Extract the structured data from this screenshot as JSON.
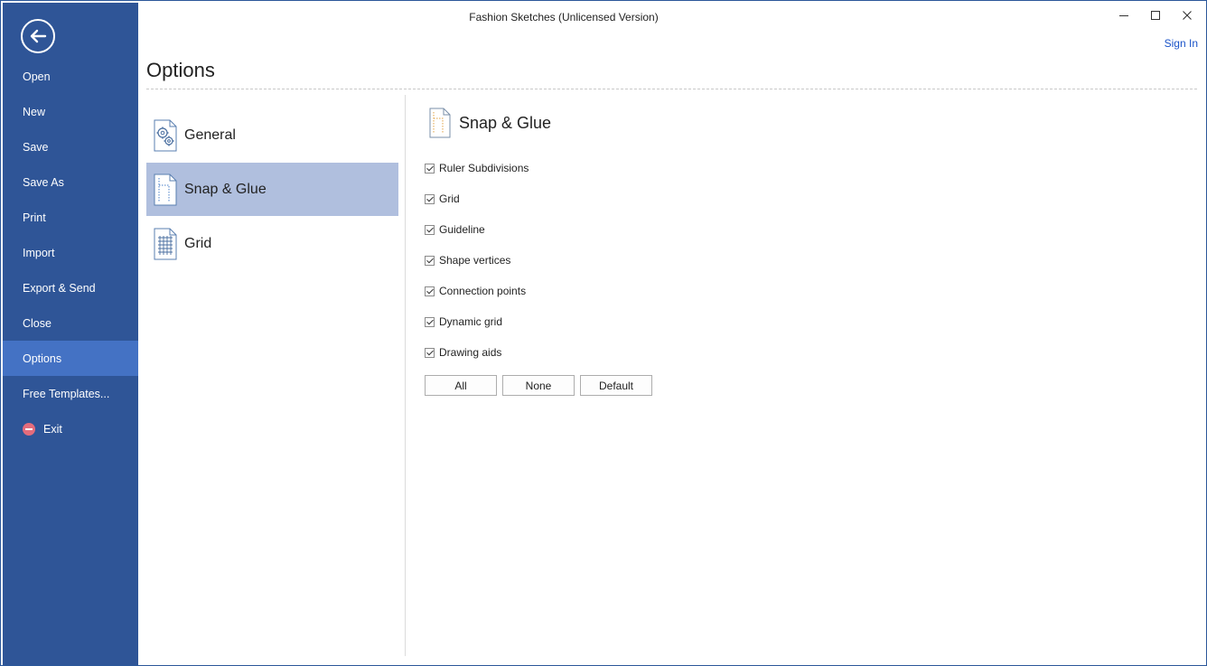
{
  "window": {
    "title": "Fashion Sketches (Unlicensed Version)",
    "sign_in": "Sign In",
    "controls": {
      "minimize": "—",
      "maximize": "☐",
      "close": "✕"
    }
  },
  "sidebar": {
    "items": [
      {
        "label": "Open"
      },
      {
        "label": "New"
      },
      {
        "label": "Save"
      },
      {
        "label": "Save As"
      },
      {
        "label": "Print"
      },
      {
        "label": "Import"
      },
      {
        "label": "Export & Send"
      },
      {
        "label": "Close"
      },
      {
        "label": "Options",
        "active": true
      },
      {
        "label": "Free Templates..."
      },
      {
        "label": "Exit",
        "icon": "exit-icon"
      }
    ]
  },
  "page": {
    "title": "Options"
  },
  "categories": [
    {
      "label": "General",
      "icon": "gear-document-icon"
    },
    {
      "label": "Snap & Glue",
      "icon": "snap-glue-icon",
      "selected": true
    },
    {
      "label": "Grid",
      "icon": "grid-document-icon"
    }
  ],
  "panel": {
    "title": "Snap & Glue",
    "options": [
      {
        "label": "Ruler Subdivisions",
        "checked": true
      },
      {
        "label": "Grid",
        "checked": true
      },
      {
        "label": "Guideline",
        "checked": true
      },
      {
        "label": "Shape vertices",
        "checked": true
      },
      {
        "label": "Connection points",
        "checked": true
      },
      {
        "label": "Dynamic grid",
        "checked": true
      },
      {
        "label": "Drawing aids",
        "checked": true
      }
    ],
    "buttons": {
      "all": "All",
      "none": "None",
      "default": "Default"
    }
  },
  "colors": {
    "sidebar": "#2f5597",
    "sidebar_active": "#4472c4",
    "selection": "#b0bfde",
    "link": "#1a53c8"
  }
}
